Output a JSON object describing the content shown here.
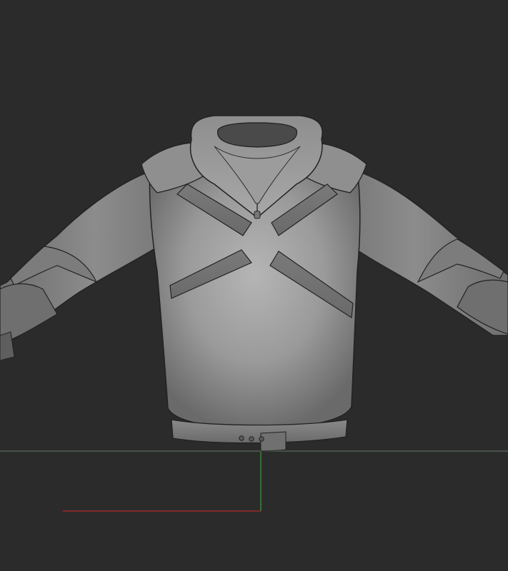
{
  "viewport": {
    "background_color": "#2b2b2b",
    "mesh_color": "#8a8a8a",
    "mesh_highlight_color": "#b8b8b8",
    "mesh_shadow_color": "#555555",
    "seam_line_color": "#1e1e1e",
    "grid_line_color": "#5a6a5a",
    "axis_x_color": "#9a2a2a",
    "axis_y_color": "#2e8a2e"
  },
  "model": {
    "subject": "hooded-jacket-sculpt"
  }
}
